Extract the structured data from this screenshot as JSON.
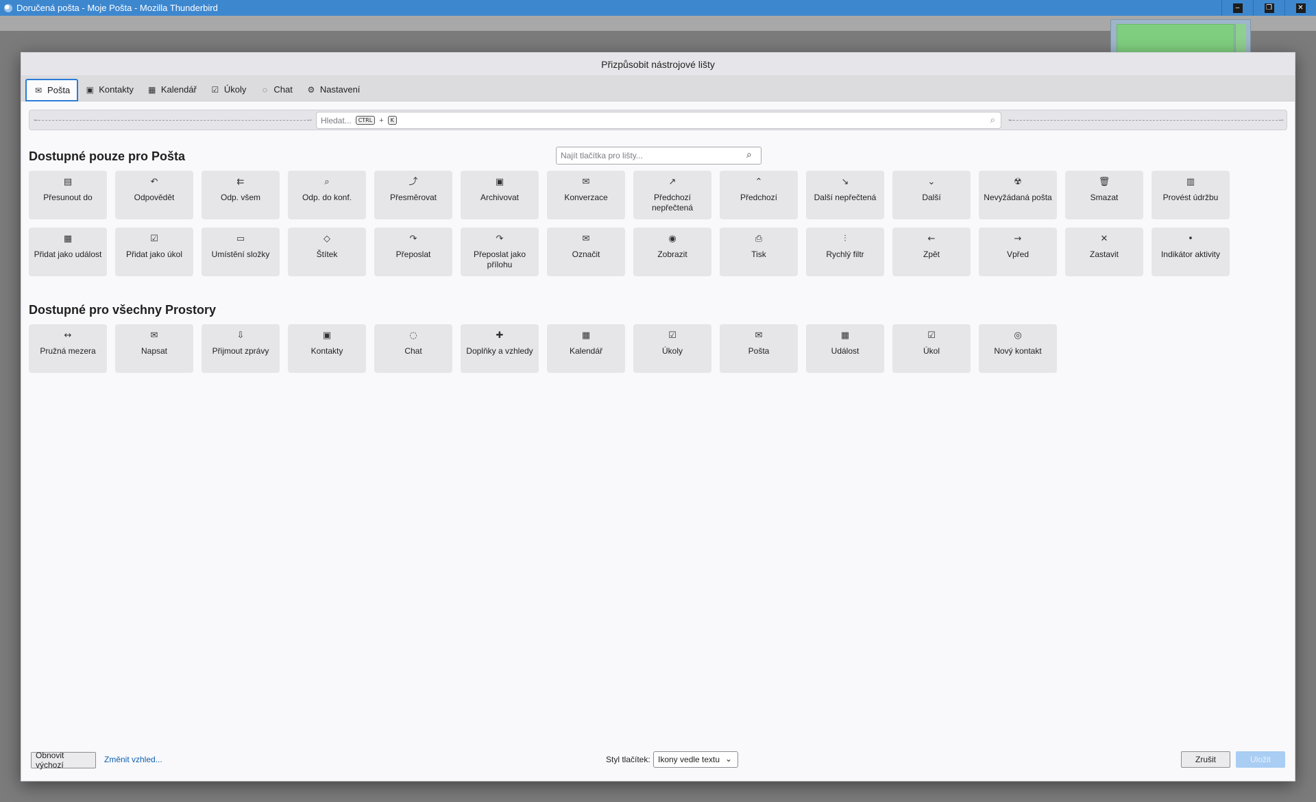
{
  "window": {
    "title": "Doručená pošta - Moje Pošta - Mozilla Thunderbird",
    "controls": [
      "minimize-icon",
      "restore-icon",
      "close-icon"
    ]
  },
  "dialog": {
    "title": "Přizpůsobit nástrojové lišty"
  },
  "tabs": [
    {
      "label": "Pošta",
      "icon": "mail-icon",
      "active": true
    },
    {
      "label": "Kontakty",
      "icon": "address-book-icon"
    },
    {
      "label": "Kalendář",
      "icon": "calendar-icon"
    },
    {
      "label": "Úkoly",
      "icon": "tasks-icon"
    },
    {
      "label": "Chat",
      "icon": "chat-icon"
    },
    {
      "label": "Nastavení",
      "icon": "gear-icon"
    }
  ],
  "toolbar_preview": {
    "search_placeholder": "Hledat...",
    "shortcut_mod": "CTRL",
    "shortcut_plus": "+",
    "shortcut_key": "K"
  },
  "find": {
    "placeholder": "Najít tlačítka pro lišty..."
  },
  "sections": {
    "mail_only_title": "Dostupné pouze pro Pošta",
    "all_spaces_title": "Dostupné pro všechny Prostory"
  },
  "mail_items": [
    {
      "label": "Přesunout do",
      "icon": "move-icon"
    },
    {
      "label": "Odpovědět",
      "icon": "reply-icon"
    },
    {
      "label": "Odp. všem",
      "icon": "reply-all-icon"
    },
    {
      "label": "Odp. do konf.",
      "icon": "reply-list-icon"
    },
    {
      "label": "Přesměrovat",
      "icon": "redirect-icon"
    },
    {
      "label": "Archivovat",
      "icon": "archive-icon"
    },
    {
      "label": "Konverzace",
      "icon": "conversation-icon"
    },
    {
      "label": "Předchozí nepřečtená",
      "icon": "previous-unread-icon"
    },
    {
      "label": "Předchozí",
      "icon": "chevron-up-icon"
    },
    {
      "label": "Další nepřečtená",
      "icon": "next-unread-icon"
    },
    {
      "label": "Další",
      "icon": "chevron-down-icon"
    },
    {
      "label": "Nevyžádaná pošta",
      "icon": "junk-icon"
    },
    {
      "label": "Smazat",
      "icon": "trash-icon"
    },
    {
      "label": "Provést údržbu",
      "icon": "compact-folder-icon"
    },
    {
      "label": "Přidat jako událost",
      "icon": "add-event-icon"
    },
    {
      "label": "Přidat jako úkol",
      "icon": "add-task-icon"
    },
    {
      "label": "Umístění složky",
      "icon": "folder-icon"
    },
    {
      "label": "Štítek",
      "icon": "tag-icon"
    },
    {
      "label": "Přeposlat",
      "icon": "forward-icon"
    },
    {
      "label": "Přeposlat jako přílohu",
      "icon": "forward-attachment-icon"
    },
    {
      "label": "Označit",
      "icon": "mark-icon"
    },
    {
      "label": "Zobrazit",
      "icon": "eye-icon"
    },
    {
      "label": "Tisk",
      "icon": "print-icon"
    },
    {
      "label": "Rychlý filtr",
      "icon": "filter-icon"
    },
    {
      "label": "Zpět",
      "icon": "arrow-left-icon"
    },
    {
      "label": "Vpřed",
      "icon": "arrow-right-icon"
    },
    {
      "label": "Zastavit",
      "icon": "stop-icon"
    },
    {
      "label": "Indikátor aktivity",
      "icon": "activity-dot-icon"
    }
  ],
  "all_items": [
    {
      "label": "Pružná mezera",
      "icon": "flexible-space-icon"
    },
    {
      "label": "Napsat",
      "icon": "compose-icon"
    },
    {
      "label": "Přijmout zprávy",
      "icon": "get-messages-icon"
    },
    {
      "label": "Kontakty",
      "icon": "address-book-icon"
    },
    {
      "label": "Chat",
      "icon": "chat-icon"
    },
    {
      "label": "Doplňky a vzhledy",
      "icon": "addons-icon"
    },
    {
      "label": "Kalendář",
      "icon": "calendar-icon"
    },
    {
      "label": "Úkoly",
      "icon": "tasks-icon"
    },
    {
      "label": "Pošta",
      "icon": "mail-icon"
    },
    {
      "label": "Událost",
      "icon": "new-event-icon"
    },
    {
      "label": "Úkol",
      "icon": "new-task-icon"
    },
    {
      "label": "Nový kontakt",
      "icon": "new-contact-icon"
    }
  ],
  "footer": {
    "reset_label": "Obnovit výchozí",
    "change_theme_label": "Změnit vzhled...",
    "button_style_label": "Styl tlačítek:",
    "button_style_value": "Ikony vedle textu",
    "cancel_label": "Zrušit",
    "save_label": "Uložit"
  },
  "colors": {
    "titlebar": "#3d87cf",
    "active_tab_border": "#2a7bd6",
    "item_bg": "#e6e6e9",
    "link": "#0b5fb0",
    "save_disabled": "#a9cdf3"
  }
}
